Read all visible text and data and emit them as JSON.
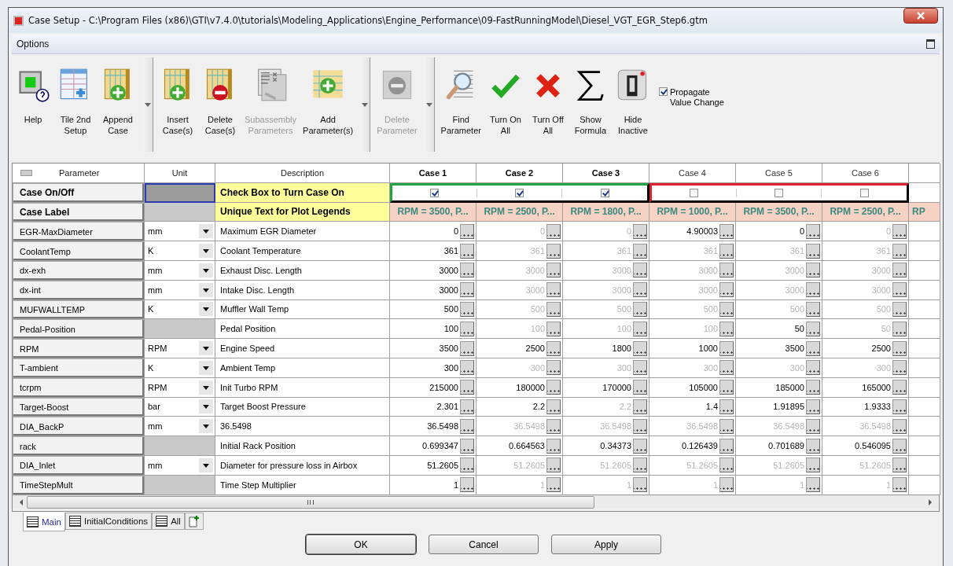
{
  "window": {
    "title": "Case Setup - C:\\Program Files (x86)\\GTI\\v7.4.0\\tutorials\\Modeling_Applications\\Engine_Performance\\09-FastRunningModel\\Diesel_VGT_EGR_Step6.gtm"
  },
  "menu": {
    "label": "Options"
  },
  "toolbar": [
    {
      "kind": "button",
      "label": "Help",
      "disabled": false
    },
    {
      "kind": "button",
      "label": "Tile 2nd\nSetup",
      "disabled": false
    },
    {
      "kind": "button",
      "label": "Append\nCase",
      "disabled": false
    },
    {
      "kind": "split"
    },
    {
      "kind": "button",
      "label": "Insert\nCase(s)",
      "disabled": false
    },
    {
      "kind": "button",
      "label": "Delete\nCase(s)",
      "disabled": false
    },
    {
      "kind": "button",
      "label": "Subassembly\nParameters",
      "disabled": true
    },
    {
      "kind": "button",
      "label": "Add\nParameter(s)",
      "disabled": false
    },
    {
      "kind": "split"
    },
    {
      "kind": "button",
      "label": "Delete\nParameter",
      "disabled": true
    },
    {
      "kind": "split"
    },
    {
      "kind": "button",
      "label": "Find\nParameter",
      "disabled": false
    },
    {
      "kind": "button",
      "label": "Turn On\nAll",
      "disabled": false
    },
    {
      "kind": "button",
      "label": "Turn Off\nAll",
      "disabled": false
    },
    {
      "kind": "button",
      "label": "Show\nFormula",
      "disabled": false
    },
    {
      "kind": "button",
      "label": "Hide\nInactive",
      "disabled": false
    }
  ],
  "propagate": {
    "label": "Propagate\nValue Change",
    "checked": true
  },
  "table": {
    "columns": [
      "Parameter",
      "Unit",
      "Description"
    ],
    "case_on_off": {
      "parameter": "Case On/Off",
      "description": "Check Box to Turn Case On"
    },
    "case_label": {
      "parameter": "Case Label",
      "description": "Unique Text for Plot Legends"
    },
    "case_groups": [
      {
        "color": "#22a345",
        "cases": [
          {
            "title": "Case 1",
            "on": true,
            "label": "RPM = 3500, P..."
          },
          {
            "title": "Case 2",
            "on": true,
            "label": "RPM = 2500, P..."
          },
          {
            "title": "Case 3",
            "on": true,
            "label": "RPM = 1800, P..."
          }
        ]
      },
      {
        "color": "#e0202c",
        "cases": [
          {
            "title": "Case 4",
            "on": false,
            "label": "RPM = 1000, P..."
          },
          {
            "title": "Case 5",
            "on": false,
            "label": "RPM = 3500, P..."
          },
          {
            "title": "Case 6",
            "on": false,
            "label": "RPM = 2500, P..."
          }
        ]
      }
    ],
    "cut_case_label": "RP",
    "rows": [
      {
        "parameter": "EGR-MaxDiameter",
        "unit": "mm",
        "description": "Maximum EGR Diameter",
        "values": [
          {
            "text": "0",
            "greyed": false
          },
          {
            "text": "0",
            "greyed": true
          },
          {
            "text": "0",
            "greyed": true
          },
          {
            "text": "4.90003",
            "greyed": false
          },
          {
            "text": "0",
            "greyed": false
          },
          {
            "text": "0",
            "greyed": true
          }
        ]
      },
      {
        "parameter": "CoolantTemp",
        "unit": "K",
        "description": "Coolant Temperature",
        "values": [
          {
            "text": "361",
            "greyed": false
          },
          {
            "text": "361",
            "greyed": true
          },
          {
            "text": "361",
            "greyed": true
          },
          {
            "text": "361",
            "greyed": true
          },
          {
            "text": "361",
            "greyed": true
          },
          {
            "text": "361",
            "greyed": true
          }
        ]
      },
      {
        "parameter": "dx-exh",
        "unit": "mm",
        "description": "Exhaust Disc. Length",
        "values": [
          {
            "text": "3000",
            "greyed": false
          },
          {
            "text": "3000",
            "greyed": true
          },
          {
            "text": "3000",
            "greyed": true
          },
          {
            "text": "3000",
            "greyed": true
          },
          {
            "text": "3000",
            "greyed": true
          },
          {
            "text": "3000",
            "greyed": true
          }
        ]
      },
      {
        "parameter": "dx-int",
        "unit": "mm",
        "description": "Intake Disc. Length",
        "values": [
          {
            "text": "3000",
            "greyed": false
          },
          {
            "text": "3000",
            "greyed": true
          },
          {
            "text": "3000",
            "greyed": true
          },
          {
            "text": "3000",
            "greyed": true
          },
          {
            "text": "3000",
            "greyed": true
          },
          {
            "text": "3000",
            "greyed": true
          }
        ]
      },
      {
        "parameter": "MUFWALLTEMP",
        "unit": "K",
        "description": "Muffler Wall Temp",
        "values": [
          {
            "text": "500",
            "greyed": false
          },
          {
            "text": "500",
            "greyed": true
          },
          {
            "text": "500",
            "greyed": true
          },
          {
            "text": "500",
            "greyed": true
          },
          {
            "text": "500",
            "greyed": true
          },
          {
            "text": "500",
            "greyed": true
          }
        ]
      },
      {
        "parameter": "Pedal-Position",
        "description": "Pedal Position",
        "values": [
          {
            "text": "100",
            "greyed": false
          },
          {
            "text": "100",
            "greyed": true
          },
          {
            "text": "100",
            "greyed": true
          },
          {
            "text": "100",
            "greyed": true
          },
          {
            "text": "50",
            "greyed": false
          },
          {
            "text": "50",
            "greyed": true
          }
        ]
      },
      {
        "parameter": "RPM",
        "unit": "RPM",
        "description": "Engine Speed",
        "values": [
          {
            "text": "3500",
            "greyed": false
          },
          {
            "text": "2500",
            "greyed": false
          },
          {
            "text": "1800",
            "greyed": false
          },
          {
            "text": "1000",
            "greyed": false
          },
          {
            "text": "3500",
            "greyed": false
          },
          {
            "text": "2500",
            "greyed": false
          }
        ]
      },
      {
        "parameter": "T-ambient",
        "unit": "K",
        "description": "Ambient Temp",
        "values": [
          {
            "text": "300",
            "greyed": false
          },
          {
            "text": "300",
            "greyed": true
          },
          {
            "text": "300",
            "greyed": true
          },
          {
            "text": "300",
            "greyed": true
          },
          {
            "text": "300",
            "greyed": true
          },
          {
            "text": "300",
            "greyed": true
          }
        ]
      },
      {
        "parameter": "tcrpm",
        "unit": "RPM",
        "description": "Init Turbo RPM",
        "values": [
          {
            "text": "215000",
            "greyed": false
          },
          {
            "text": "180000",
            "greyed": false
          },
          {
            "text": "170000",
            "greyed": false
          },
          {
            "text": "105000",
            "greyed": false
          },
          {
            "text": "185000",
            "greyed": false
          },
          {
            "text": "165000",
            "greyed": false
          }
        ]
      },
      {
        "parameter": "Target-Boost",
        "unit": "bar",
        "description": "Target Boost Pressure",
        "values": [
          {
            "text": "2.301",
            "greyed": false
          },
          {
            "text": "2.2",
            "greyed": false
          },
          {
            "text": "2.2",
            "greyed": true
          },
          {
            "text": "1.4",
            "greyed": false
          },
          {
            "text": "1.91895",
            "greyed": false
          },
          {
            "text": "1.9333",
            "greyed": false
          }
        ]
      },
      {
        "parameter": "DIA_BackP",
        "unit": "mm",
        "description": "36.5498",
        "values": [
          {
            "text": "36.5498",
            "greyed": false
          },
          {
            "text": "36.5498",
            "greyed": true
          },
          {
            "text": "36.5498",
            "greyed": true
          },
          {
            "text": "36.5498",
            "greyed": true
          },
          {
            "text": "36.5498",
            "greyed": true
          },
          {
            "text": "36.5498",
            "greyed": true
          }
        ]
      },
      {
        "parameter": "rack",
        "description": "Initial Rack Position",
        "values": [
          {
            "text": "0.699347",
            "greyed": false
          },
          {
            "text": "0.664563",
            "greyed": false
          },
          {
            "text": "0.34373",
            "greyed": false
          },
          {
            "text": "0.126439",
            "greyed": false
          },
          {
            "text": "0.701689",
            "greyed": false
          },
          {
            "text": "0.546095",
            "greyed": false
          }
        ]
      },
      {
        "parameter": "DIA_Inlet",
        "unit": "mm",
        "description": "Diameter for pressure loss in Airbox",
        "values": [
          {
            "text": "51.2605",
            "greyed": false
          },
          {
            "text": "51.2605",
            "greyed": true
          },
          {
            "text": "51.2605",
            "greyed": true
          },
          {
            "text": "51.2605",
            "greyed": true
          },
          {
            "text": "51.2605",
            "greyed": true
          },
          {
            "text": "51.2605",
            "greyed": true
          }
        ]
      },
      {
        "parameter": "TimeStepMult",
        "description": "Time Step Multiplier",
        "values": [
          {
            "text": "1",
            "greyed": false
          },
          {
            "text": "1",
            "greyed": true
          },
          {
            "text": "1",
            "greyed": true
          },
          {
            "text": "1",
            "greyed": true
          },
          {
            "text": "1",
            "greyed": true
          },
          {
            "text": "1",
            "greyed": true
          }
        ]
      }
    ]
  },
  "sheet_tabs": [
    {
      "label": "Main",
      "selected": true
    },
    {
      "label": "InitialConditions",
      "selected": false
    },
    {
      "label": "All",
      "selected": false
    }
  ],
  "buttons": [
    "OK",
    "Cancel",
    "Apply"
  ]
}
